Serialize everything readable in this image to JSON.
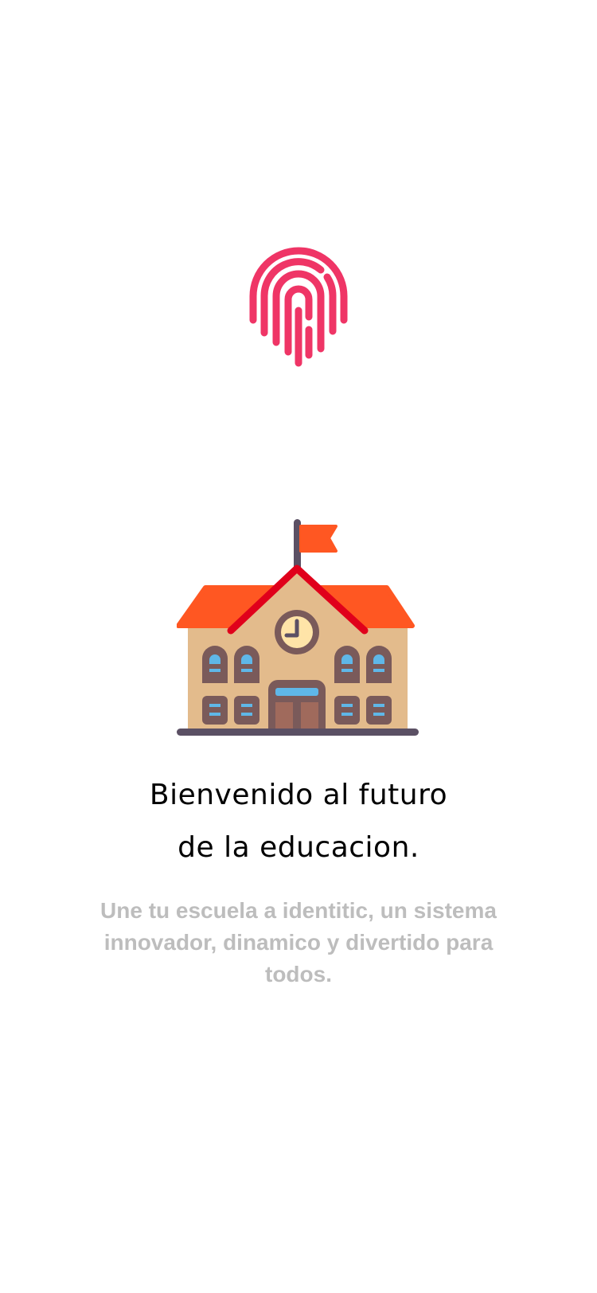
{
  "colors": {
    "background": "#ffffff",
    "fingerprint": "#ef3566",
    "headline": "#000000",
    "subtext": "#bdbdbd",
    "roof": "#ff5722",
    "roof_line": "#e0001b",
    "wall": "#e3bb8c",
    "trim": "#7a5a5a",
    "window_glass": "#5fb7e8",
    "clock_face": "#ffe4a8",
    "pole": "#5b5064"
  },
  "icons": {
    "brand": "fingerprint-icon",
    "illustration": "school-building-icon"
  },
  "welcome": {
    "title_line1": "Bienvenido al futuro",
    "title_line2": "de la educacion.",
    "subtitle": "Une tu escuela a identitic, un sistema innovador, dinamico y divertido para todos."
  }
}
